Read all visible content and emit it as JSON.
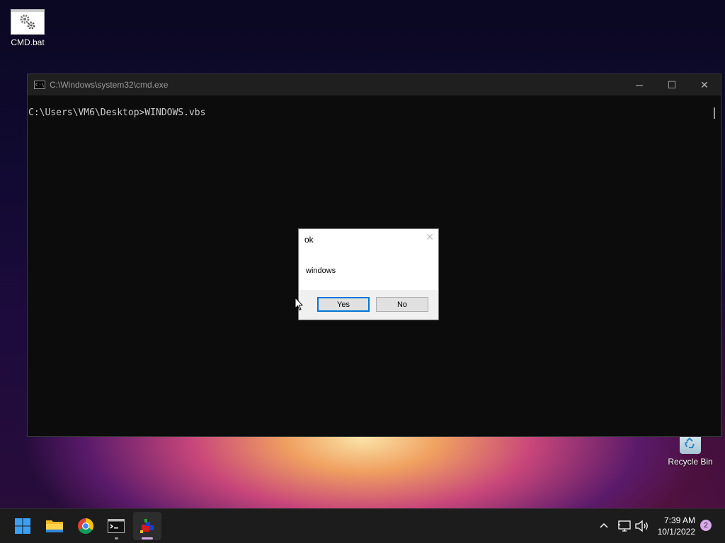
{
  "desktop": {
    "icons": [
      {
        "label": "CMD.bat",
        "icon": "batch-file-gear-icon"
      },
      {
        "label": "Recycle Bin",
        "icon": "recycle-bin-icon"
      }
    ]
  },
  "cmd_window": {
    "title": "C:\\Windows\\system32\\cmd.exe",
    "console_line": "C:\\Users\\VM6\\Desktop>WINDOWS.vbs",
    "controls": {
      "minimize": "─",
      "maximize": "☐",
      "close": "✕"
    }
  },
  "message_box": {
    "title": "ok",
    "text": "windows",
    "close_glyph": "✕",
    "buttons": {
      "yes": "Yes",
      "no": "No"
    }
  },
  "taskbar": {
    "items": [
      "start-icon",
      "file-explorer-icon",
      "chrome-icon",
      "terminal-icon",
      "vbs-script-icon"
    ],
    "clock": {
      "time": "7:39 AM",
      "date": "10/1/2022"
    },
    "notification_count": "2"
  },
  "colors": {
    "accent": "#0078d7",
    "indicator": "#d9a8ea"
  }
}
